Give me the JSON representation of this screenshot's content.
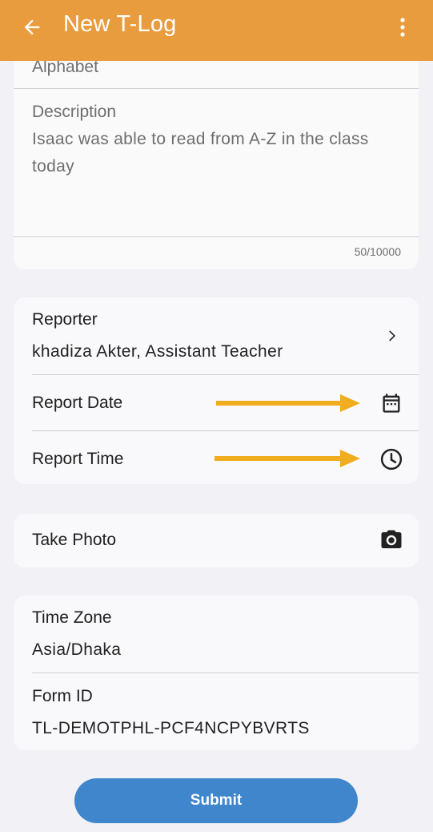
{
  "appbar": {
    "title": "New T-Log",
    "back_icon": "arrow-left-icon",
    "menu_icon": "more-vert-icon",
    "color": "#e89c3e"
  },
  "details": {
    "title_value": "Alphabet",
    "description_label": "Description",
    "description_value": "Isaac was able to read from A-Z in the class today",
    "char_count": "50/10000"
  },
  "report": {
    "reporter_label": "Reporter",
    "reporter_value": "khadiza Akter, Assistant Teacher",
    "report_date_label": "Report Date",
    "report_time_label": "Report Time"
  },
  "photo": {
    "label": "Take Photo"
  },
  "meta": {
    "timezone_label": "Time Zone",
    "timezone_value": "Asia/Dhaka",
    "form_id_label": "Form ID",
    "form_id_value": "TL-DEMOTPHL-PCF4NCPYBVRTS"
  },
  "submit_label": "Submit",
  "colors": {
    "accent": "#e89c3e",
    "primary_button": "#3f86cc",
    "annotation_arrow": "#f0ad1e",
    "background": "#f1f1f6"
  }
}
